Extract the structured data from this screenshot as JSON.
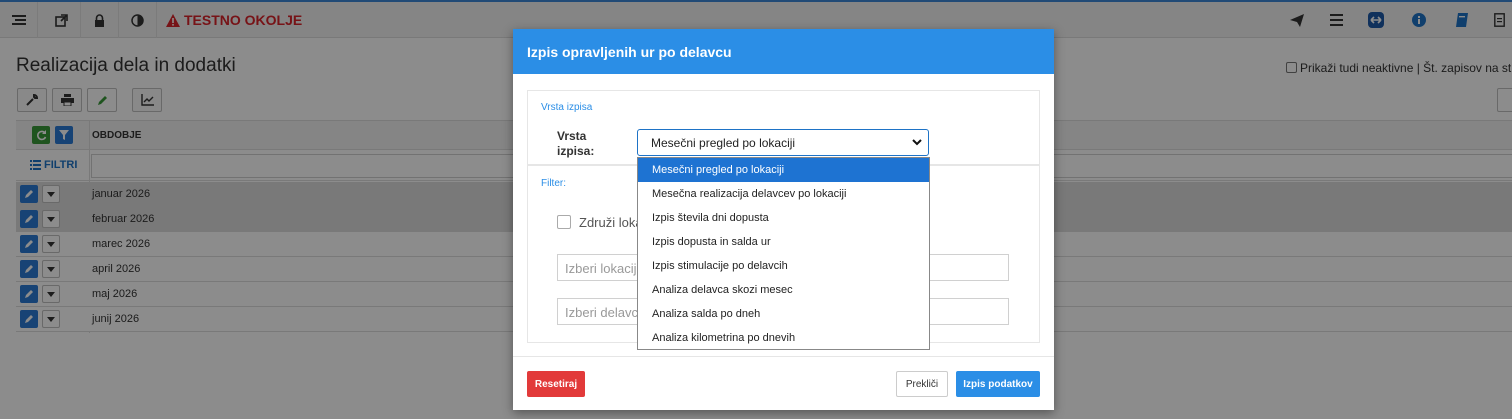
{
  "topbar": {
    "env_label": "TESTNO OKOLJE"
  },
  "page": {
    "title": "Realizacija dela in dodatki"
  },
  "options": {
    "show_inactive": "Prikaži tudi neaktivne | Št. zapisov na strani:"
  },
  "grid": {
    "header": "OBDOBJE",
    "filter_label": "FILTRI",
    "rows": [
      {
        "label": "januar 2026"
      },
      {
        "label": "februar 2026"
      },
      {
        "label": "marec 2026"
      },
      {
        "label": "april 2026"
      },
      {
        "label": "maj 2026"
      },
      {
        "label": "junij 2026"
      }
    ]
  },
  "modal": {
    "title": "Izpis opravljenih ur po delavcu",
    "section1_title": "Vrsta izpisa",
    "vrsta_label_1": "Vrsta",
    "vrsta_label_2": "izpisa:",
    "selected": "Mesečni pregled po lokaciji",
    "section2_title": "Filter:",
    "combine_label": "Združi loka",
    "location_placeholder": "Izberi lokacijo",
    "worker_placeholder": "Izberi delavce",
    "reset": "Resetiraj",
    "cancel": "Prekliči",
    "submit": "Izpis podatkov"
  },
  "dropdown": {
    "options": [
      "Mesečni pregled po lokaciji",
      "Mesečna realizacija delavcev po lokaciji",
      "Izpis števila dni dopusta",
      "Izpis dopusta in salda ur",
      "Izpis stimulacije po delavcih",
      "Analiza delavca skozi mesec",
      "Analiza salda po dneh",
      "Analiza kilometrina po dnevih"
    ],
    "active_index": 0
  },
  "colors": {
    "accent": "#2b8ee6",
    "danger": "#e23a3a",
    "env": "#d9232a"
  }
}
